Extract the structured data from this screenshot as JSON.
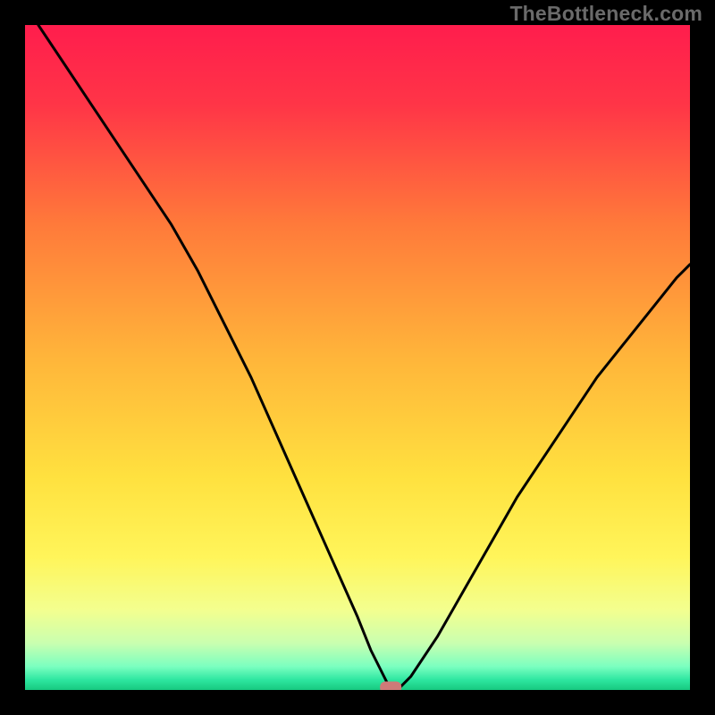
{
  "watermark": "TheBottleneck.com",
  "chart_data": {
    "type": "line",
    "title": "",
    "xlabel": "",
    "ylabel": "",
    "xlim": [
      0,
      100
    ],
    "ylim": [
      0,
      100
    ],
    "grid": false,
    "legend": false,
    "curve": {
      "name": "bottleneck-curve",
      "comment": "V-shaped curve; minimum near x≈55; values estimated from gradient position",
      "x": [
        2,
        6,
        10,
        14,
        18,
        22,
        26,
        30,
        34,
        38,
        42,
        46,
        50,
        52,
        54,
        55,
        56,
        58,
        62,
        66,
        70,
        74,
        78,
        82,
        86,
        90,
        94,
        98,
        100
      ],
      "y": [
        100,
        94,
        88,
        82,
        76,
        70,
        63,
        55,
        47,
        38,
        29,
        20,
        11,
        6,
        2,
        0,
        0,
        2,
        8,
        15,
        22,
        29,
        35,
        41,
        47,
        52,
        57,
        62,
        64
      ]
    },
    "marker": {
      "name": "optimal-point",
      "x": 55,
      "y": 0,
      "shape": "rounded-rect",
      "color": "#cf7a78"
    },
    "background_gradient": {
      "type": "vertical",
      "stops": [
        {
          "pos": 0.0,
          "color": "#ff1d4d"
        },
        {
          "pos": 0.12,
          "color": "#ff3547"
        },
        {
          "pos": 0.3,
          "color": "#ff7a3a"
        },
        {
          "pos": 0.5,
          "color": "#ffb53a"
        },
        {
          "pos": 0.68,
          "color": "#ffe13f"
        },
        {
          "pos": 0.8,
          "color": "#fff55a"
        },
        {
          "pos": 0.88,
          "color": "#f3ff8f"
        },
        {
          "pos": 0.93,
          "color": "#c9ffb0"
        },
        {
          "pos": 0.965,
          "color": "#7affc0"
        },
        {
          "pos": 0.985,
          "color": "#2de6a0"
        },
        {
          "pos": 1.0,
          "color": "#17c87f"
        }
      ]
    },
    "curve_style": {
      "stroke": "#000000",
      "width": 3
    },
    "marker_style": {
      "fill": "#cf7a78",
      "rx": 6,
      "w": 24,
      "h": 13
    }
  }
}
